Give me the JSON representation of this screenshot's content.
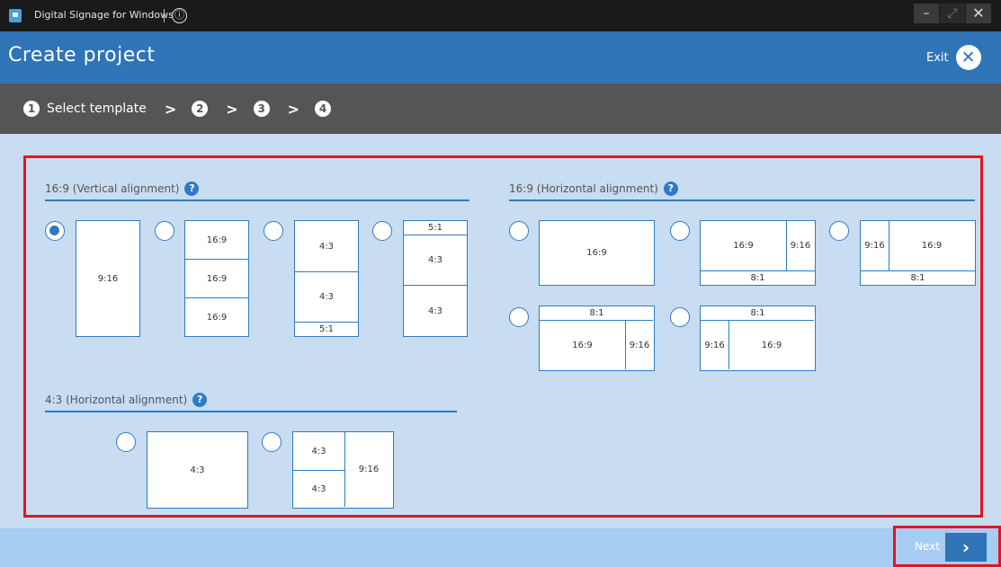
{
  "window": {
    "title": "Digital Signage for Windows",
    "info_icon": "ⓘ",
    "min_icon": "–",
    "max_icon": "⤢",
    "close_icon": "✕"
  },
  "header": {
    "title": "Create project",
    "exit_label": "Exit",
    "exit_icon": "✕"
  },
  "steps": [
    {
      "num": "1",
      "label": "Select template"
    },
    {
      "num": "2"
    },
    {
      "num": "3"
    },
    {
      "num": "4"
    }
  ],
  "step_separator": ">",
  "help_icon": "?",
  "sections": {
    "v169": {
      "title": "16:9 (Vertical alignment)"
    },
    "h169": {
      "title": "16:9 (Horizontal alignment)"
    },
    "h43": {
      "title": "4:3 (Horizontal alignment)"
    }
  },
  "templates": {
    "v1": [
      "9:16"
    ],
    "v2": [
      "16:9",
      "16:9",
      "16:9"
    ],
    "v3": [
      "4:3",
      "4:3",
      "5:1"
    ],
    "v4": [
      "5:1",
      "4:3",
      "4:3"
    ],
    "h1": [
      "16:9"
    ],
    "h2": [
      "16:9",
      "9:16",
      "8:1"
    ],
    "h3": [
      "9:16",
      "16:9",
      "8:1"
    ],
    "h4": [
      "8:1",
      "16:9",
      "9:16"
    ],
    "h5": [
      "8:1",
      "9:16",
      "16:9"
    ],
    "f1": [
      "4:3"
    ],
    "f2": [
      "4:3",
      "4:3",
      "9:16"
    ]
  },
  "selected_template": "v1",
  "footer": {
    "next_label": "Next",
    "next_icon": "›"
  }
}
